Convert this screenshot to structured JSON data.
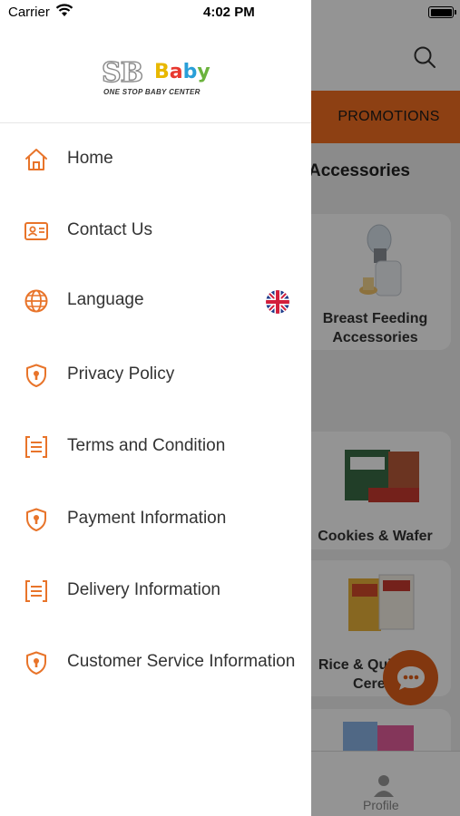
{
  "status_bar": {
    "carrier": "Carrier",
    "time": "4:02 PM"
  },
  "drawer": {
    "logo": {
      "brand_sb": "SB",
      "brand_baby": "Baby",
      "tagline": "ONE STOP BABY CENTER"
    },
    "menu": [
      {
        "label": "Home",
        "icon": "home-icon"
      },
      {
        "label": "Contact Us",
        "icon": "contact-card-icon"
      },
      {
        "label": "Language",
        "icon": "globe-icon",
        "flag": "uk-flag-icon"
      },
      {
        "label": "Privacy Policy",
        "icon": "shield-lock-icon"
      },
      {
        "label": "Terms and Condition",
        "icon": "document-list-icon"
      },
      {
        "label": "Payment Information",
        "icon": "shield-lock-icon"
      },
      {
        "label": "Delivery Information",
        "icon": "document-list-icon"
      },
      {
        "label": "Customer Service Information",
        "icon": "shield-lock-icon"
      }
    ]
  },
  "background": {
    "promo_button": "PROMOTIONS",
    "section_title": "Accessories",
    "cards": [
      {
        "label_line1": "Breast Feeding",
        "label_line2": "Accessories"
      },
      {
        "label_line1": "Cookies & Wafer",
        "label_line2": ""
      },
      {
        "label_line1": "Rice & Quinoa &",
        "label_line2": "Cereal"
      }
    ],
    "bottom_nav": {
      "profile_label": "Profile"
    }
  },
  "colors": {
    "accent": "#f36f21",
    "icon": "#e8742a",
    "overlay": "rgba(0,0,0,0.42)"
  }
}
